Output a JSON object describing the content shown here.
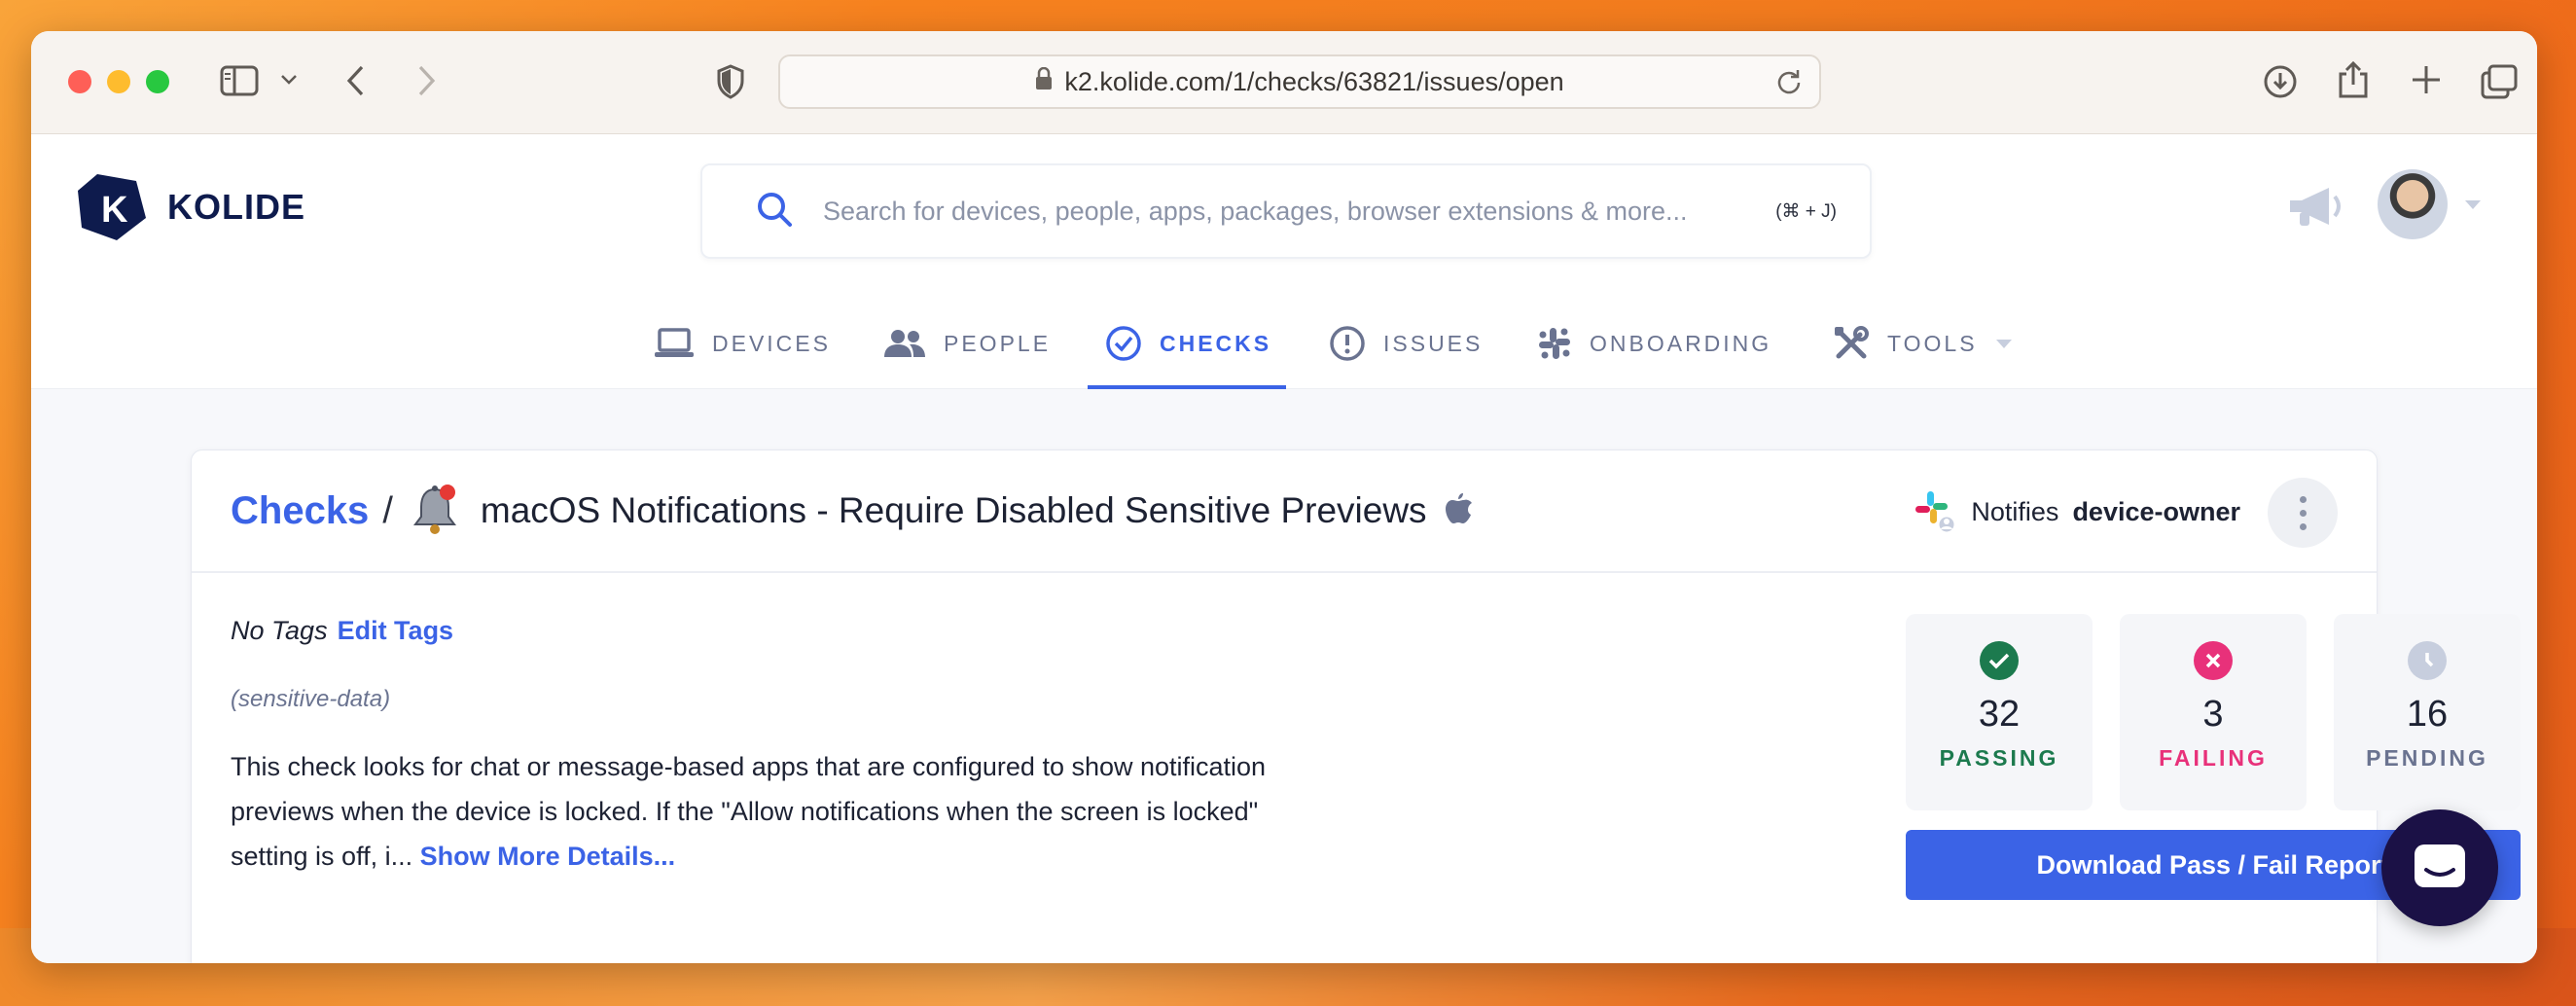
{
  "browser": {
    "url": "k2.kolide.com/1/checks/63821/issues/open"
  },
  "app": {
    "brand": "KOLIDE",
    "search": {
      "placeholder": "Search for devices, people, apps, packages, browser extensions & more...",
      "shortcut": "(⌘ + J)"
    },
    "nav": [
      {
        "label": "DEVICES",
        "icon": "laptop-icon"
      },
      {
        "label": "PEOPLE",
        "icon": "people-icon"
      },
      {
        "label": "CHECKS",
        "icon": "check-circle-icon",
        "active": true
      },
      {
        "label": "ISSUES",
        "icon": "exclamation-circle-icon"
      },
      {
        "label": "ONBOARDING",
        "icon": "slack-icon"
      },
      {
        "label": "TOOLS",
        "icon": "tools-icon",
        "has_dropdown": true
      }
    ]
  },
  "check": {
    "breadcrumb": "Checks",
    "separator": "/",
    "title": "macOS Notifications - Require Disabled Sensitive Previews",
    "notifies_prefix": "Notifies",
    "notifies_target": "device-owner",
    "no_tags": "No Tags",
    "edit_tags": "Edit Tags",
    "tag": "(sensitive-data)",
    "description": "This check looks for chat or message-based apps that are configured to show notification previews when the device is locked. If the \"Allow notifications when the screen is locked\" setting is off, i...",
    "show_more": "Show More Details...",
    "stats": {
      "passing": {
        "count": "32",
        "label": "PASSING",
        "color": "#1c7a4e"
      },
      "failing": {
        "count": "3",
        "label": "FAILING",
        "color": "#e8317a"
      },
      "pending": {
        "count": "16",
        "label": "PENDING",
        "color": "#6a7390"
      }
    },
    "download_label": "Download Pass / Fail Report"
  },
  "colors": {
    "accent": "#3b63e6",
    "brand_dark": "#0e1b4d"
  }
}
